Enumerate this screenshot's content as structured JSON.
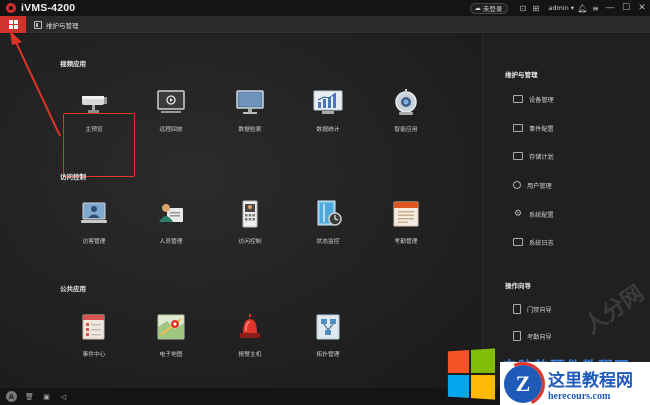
{
  "app": {
    "title": "iVMS-4200"
  },
  "titlebar": {
    "login_status": "未登录",
    "user": "admin"
  },
  "tabs": {
    "maintenance_label": "维护与管理"
  },
  "sections": {
    "video": {
      "title": "视频应用",
      "items": [
        {
          "label": "主预览",
          "icon": "camera-icon"
        },
        {
          "label": "远程回放",
          "icon": "playback-icon"
        },
        {
          "label": "数据检索",
          "icon": "monitor-search-icon"
        },
        {
          "label": "数据统计",
          "icon": "statistics-icon"
        },
        {
          "label": "智能应用",
          "icon": "robot-icon"
        }
      ]
    },
    "access": {
      "title": "访问控制",
      "items": [
        {
          "label": "访客管理",
          "icon": "visitor-icon"
        },
        {
          "label": "人员管理",
          "icon": "person-card-icon"
        },
        {
          "label": "访问控制",
          "icon": "door-panel-icon"
        },
        {
          "label": "状态监控",
          "icon": "door-monitor-icon"
        },
        {
          "label": "考勤管理",
          "icon": "calendar-icon"
        }
      ]
    },
    "public": {
      "title": "公共应用",
      "items": [
        {
          "label": "事件中心",
          "icon": "event-list-icon"
        },
        {
          "label": "电子地图",
          "icon": "map-icon"
        },
        {
          "label": "报警主机",
          "icon": "alarm-siren-icon"
        },
        {
          "label": "拓扑管理",
          "icon": "topology-icon"
        }
      ]
    }
  },
  "right_panel": {
    "maint_title": "维护与管理",
    "maint_items": [
      {
        "label": "设备管理",
        "icon": "device-icon"
      },
      {
        "label": "事件配置",
        "icon": "event-config-icon"
      },
      {
        "label": "存储计划",
        "icon": "storage-icon"
      },
      {
        "label": "用户管理",
        "icon": "user-icon"
      },
      {
        "label": "系统配置",
        "icon": "gear-icon"
      },
      {
        "label": "系统日志",
        "icon": "log-icon"
      }
    ],
    "guide_title": "操作向导",
    "guide_items": [
      {
        "label": "门禁向导",
        "icon": "door-guide-icon"
      },
      {
        "label": "考勤向导",
        "icon": "attendance-guide-icon"
      }
    ]
  },
  "watermark": {
    "diagonal": "人分网",
    "site_text": "电脑软硬件教程网",
    "brand_cn": "这里教程网",
    "brand_url": "herecours.com",
    "brand_letter": "Z"
  },
  "colors": {
    "accent": "#d0322c",
    "highlight_border": "#e0342a",
    "background": "#1b1b1b"
  }
}
